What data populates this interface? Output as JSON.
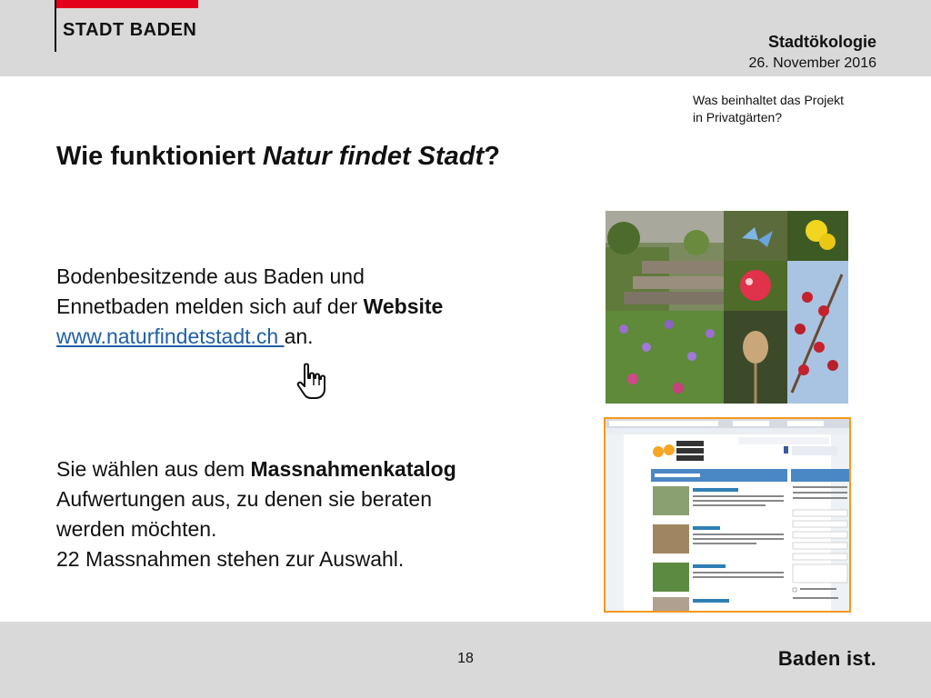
{
  "header": {
    "logo_text": "STADT BADEN",
    "section_title": "Stadtökologie",
    "date": "26. November 2016"
  },
  "subquestion": {
    "line1": "Was beinhaltet das Projekt",
    "line2": "in Privatgärten?"
  },
  "title": {
    "prefix": "Wie funktioniert ",
    "italic": "Natur findet Stadt",
    "suffix": "?"
  },
  "para1": {
    "line1": "Bodenbesitzende aus Baden und",
    "line2_prefix": "Ennetbaden melden sich auf der ",
    "line2_bold": "Website",
    "link_text": "www.naturfindetstadt.ch ",
    "line3_suffix": "an."
  },
  "para2": {
    "line1_prefix": "Sie wählen aus dem ",
    "line1_bold": "Massnahmenkatalog",
    "line2": "Aufwertungen aus, zu denen sie beraten",
    "line3": "werden möchten.",
    "line4": "22 Massnahmen stehen zur Auswahl."
  },
  "icons": {
    "cursor": "hand-pointer-icon"
  },
  "footer": {
    "page_number": "18",
    "tagline": "Baden ist."
  },
  "colors": {
    "header_bg": "#d9d9d9",
    "logo_red": "#e2001a",
    "link": "#1f5fa8",
    "screenshot_border": "#f39a1d"
  }
}
